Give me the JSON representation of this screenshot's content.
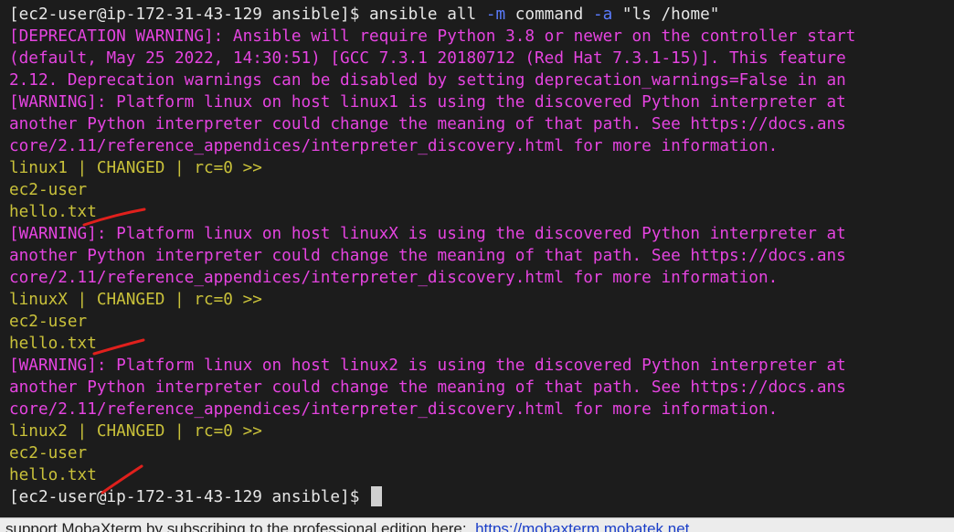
{
  "terminal": {
    "colors": {
      "background": "#1c1c1c",
      "text": "#e6e6e6",
      "warning": "#e544e0",
      "result": "#c9c13a",
      "flag": "#5b7cff",
      "annotation": "#e0201c"
    },
    "command": {
      "prompt": "[ec2-user@ip-172-31-43-129 ansible]$ ",
      "cmd1": "ansible all ",
      "flag_m": "-m",
      "cmd2": " command ",
      "flag_a": "-a",
      "cmd3": " \"ls /home\""
    },
    "lines": {
      "dep1": "[DEPRECATION WARNING]: Ansible will require Python 3.8 or newer on the controller start",
      "dep2": "(default, May 25 2022, 14:30:51) [GCC 7.3.1 20180712 (Red Hat 7.3.1-15)]. This feature",
      "dep3": "2.12. Deprecation warnings can be disabled by setting deprecation_warnings=False in an",
      "w1a": "[WARNING]: Platform linux on host linux1 is using the discovered Python interpreter at",
      "w1b": "another Python interpreter could change the meaning of that path. See https://docs.ans",
      "w1c": "core/2.11/reference_appendices/interpreter_discovery.html for more information.",
      "r1": "linux1 | CHANGED | rc=0 >>",
      "o1a": "ec2-user",
      "o1b": "hello.txt",
      "w2a": "[WARNING]: Platform linux on host linuxX is using the discovered Python interpreter at",
      "w2b": "another Python interpreter could change the meaning of that path. See https://docs.ans",
      "w2c": "core/2.11/reference_appendices/interpreter_discovery.html for more information.",
      "r2": "linuxX | CHANGED | rc=0 >>",
      "o2a": "ec2-user",
      "o2b": "hello.txt",
      "w3a": "[WARNING]: Platform linux on host linux2 is using the discovered Python interpreter at",
      "w3b": "another Python interpreter could change the meaning of that path. See https://docs.ans",
      "w3c": "core/2.11/reference_appendices/interpreter_discovery.html for more information.",
      "r3": "linux2 | CHANGED | rc=0 >>",
      "o3a": "ec2-user",
      "o3b": "hello.txt",
      "final_prompt": "[ec2-user@ip-172-31-43-129 ansible]$ "
    }
  },
  "status_bar": {
    "text": "support MobaXterm by subscribing to the professional edition here:  ",
    "link": "https://mobaxterm.mobatek.net"
  }
}
